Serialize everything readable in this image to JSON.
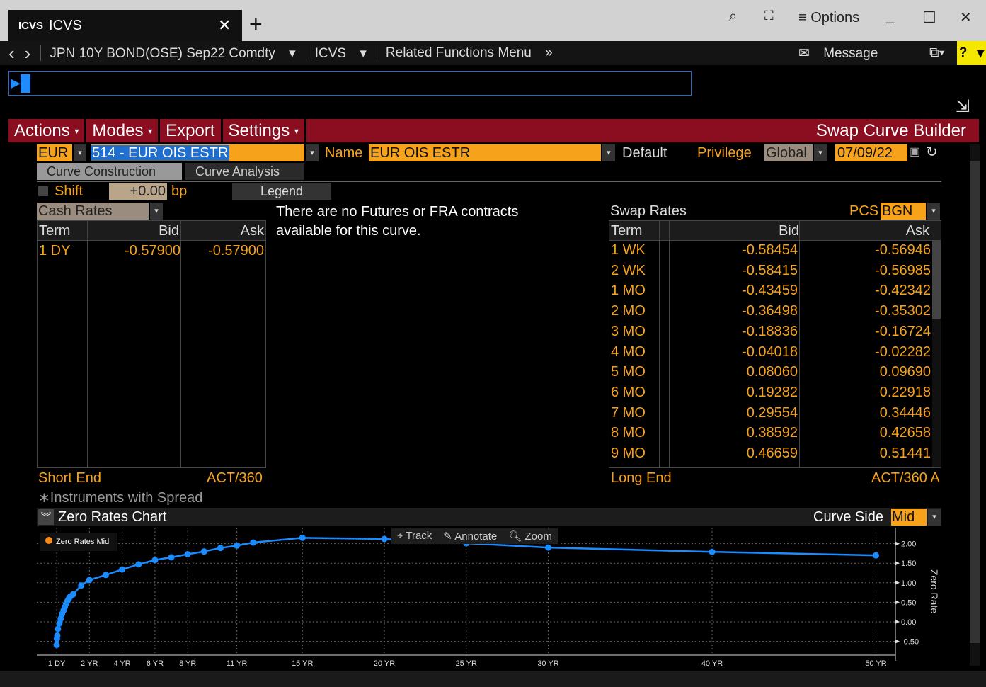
{
  "window": {
    "tab_icon": "ICVS",
    "tab_title": "ICVS",
    "close": "✕",
    "new_tab": "+",
    "options": "Options",
    "search_icon": "search-plus-icon",
    "fullscreen_icon": "expand-icon",
    "minimize": "_",
    "maximize": "☐",
    "close_window": "✕"
  },
  "nav": {
    "back": "‹",
    "forward": "›",
    "security": "JPN 10Y BOND(OSE) Sep22 Comdty",
    "function": "ICVS",
    "related": "Related Functions Menu",
    "message": "Message",
    "help": "?"
  },
  "menu": {
    "items": [
      "Actions",
      "Modes",
      "Export",
      "Settings"
    ],
    "title": "Swap Curve Builder"
  },
  "curve": {
    "currency": "EUR",
    "curve_id": "514 - EUR OIS ESTR",
    "name_label": "Name",
    "name_value": "EUR OIS ESTR",
    "default": "Default",
    "privilege_label": "Privilege",
    "privilege_value": "Global",
    "date": "07/09/22"
  },
  "tabs": [
    "Curve Construction",
    "Curve Analysis"
  ],
  "shift": {
    "label": "Shift",
    "value": "+0.00",
    "unit": "bp",
    "legend": "Legend"
  },
  "cash": {
    "title": "Cash Rates",
    "headers": [
      "Term",
      "Bid",
      "Ask"
    ],
    "rows": [
      [
        "1 DY",
        "-0.57900",
        "-0.57900"
      ]
    ],
    "short_end": "Short End",
    "daycount": "ACT/360"
  },
  "futures_msg": "There are no Futures or FRA contracts available for this curve.",
  "swap": {
    "title": "Swap Rates",
    "pcs_label": "PCS",
    "pcs_value": "BGN",
    "headers": [
      "Term",
      "Bid",
      "Ask"
    ],
    "rows": [
      [
        "1 WK",
        "-0.58454",
        "-0.56946"
      ],
      [
        "2 WK",
        "-0.58415",
        "-0.56985"
      ],
      [
        "1 MO",
        "-0.43459",
        "-0.42342"
      ],
      [
        "2 MO",
        "-0.36498",
        "-0.35302"
      ],
      [
        "3 MO",
        "-0.18836",
        "-0.16724"
      ],
      [
        "4 MO",
        "-0.04018",
        "-0.02282"
      ],
      [
        "5 MO",
        "0.08060",
        "0.09690"
      ],
      [
        "6 MO",
        "0.19282",
        "0.22918"
      ],
      [
        "7 MO",
        "0.29554",
        "0.34446"
      ],
      [
        "8 MO",
        "0.38592",
        "0.42658"
      ],
      [
        "9 MO",
        "0.46659",
        "0.51441"
      ]
    ],
    "long_end": "Long End",
    "daycount": "ACT/360 A"
  },
  "instruments_note": "∗Instruments with Spread",
  "chart_panel": {
    "title": "Zero Rates Chart",
    "curve_side_label": "Curve Side",
    "curve_side_value": "Mid",
    "tools": [
      "Track",
      "Annotate",
      "Zoom"
    ]
  },
  "chart_data": {
    "type": "line",
    "legend": [
      {
        "name": "Zero Rates Mid",
        "color": "#f7891b"
      }
    ],
    "legend_placement": "top-left",
    "series_color": "#1a8cff",
    "ylabel": "Zero Rate",
    "yaxis_side": "right",
    "ylim": [
      -0.8,
      2.4
    ],
    "yticks": [
      "2.00",
      "1.50",
      "1.00",
      "0.50",
      "0.00",
      "-0.50"
    ],
    "grid": true,
    "xticks": [
      {
        "label": "1 DY",
        "x": 0.003
      },
      {
        "label": "2 YR",
        "x": 2
      },
      {
        "label": "4 YR",
        "x": 4
      },
      {
        "label": "6 YR",
        "x": 6
      },
      {
        "label": "8 YR",
        "x": 8
      },
      {
        "label": "11 YR",
        "x": 11
      },
      {
        "label": "15 YR",
        "x": 15
      },
      {
        "label": "20 YR",
        "x": 20
      },
      {
        "label": "25 YR",
        "x": 25
      },
      {
        "label": "30 YR",
        "x": 30
      },
      {
        "label": "40 YR",
        "x": 40
      },
      {
        "label": "50 YR",
        "x": 50
      }
    ],
    "points": [
      [
        0.003,
        -0.59
      ],
      [
        0.02,
        -0.43
      ],
      [
        0.04,
        -0.35
      ],
      [
        0.083,
        -0.18
      ],
      [
        0.167,
        -0.04
      ],
      [
        0.25,
        0.08
      ],
      [
        0.33,
        0.2
      ],
      [
        0.42,
        0.29
      ],
      [
        0.5,
        0.38
      ],
      [
        0.58,
        0.46
      ],
      [
        0.67,
        0.54
      ],
      [
        0.75,
        0.6
      ],
      [
        0.83,
        0.65
      ],
      [
        1,
        0.7
      ],
      [
        1.5,
        0.93
      ],
      [
        2,
        1.07
      ],
      [
        3,
        1.2
      ],
      [
        4,
        1.34
      ],
      [
        5,
        1.47
      ],
      [
        6,
        1.58
      ],
      [
        7,
        1.65
      ],
      [
        8,
        1.73
      ],
      [
        9,
        1.8
      ],
      [
        10,
        1.89
      ],
      [
        11,
        1.95
      ],
      [
        12,
        2.03
      ],
      [
        15,
        2.15
      ],
      [
        20,
        2.12
      ],
      [
        25,
        2.01
      ],
      [
        30,
        1.9
      ],
      [
        40,
        1.79
      ],
      [
        50,
        1.7
      ]
    ]
  }
}
